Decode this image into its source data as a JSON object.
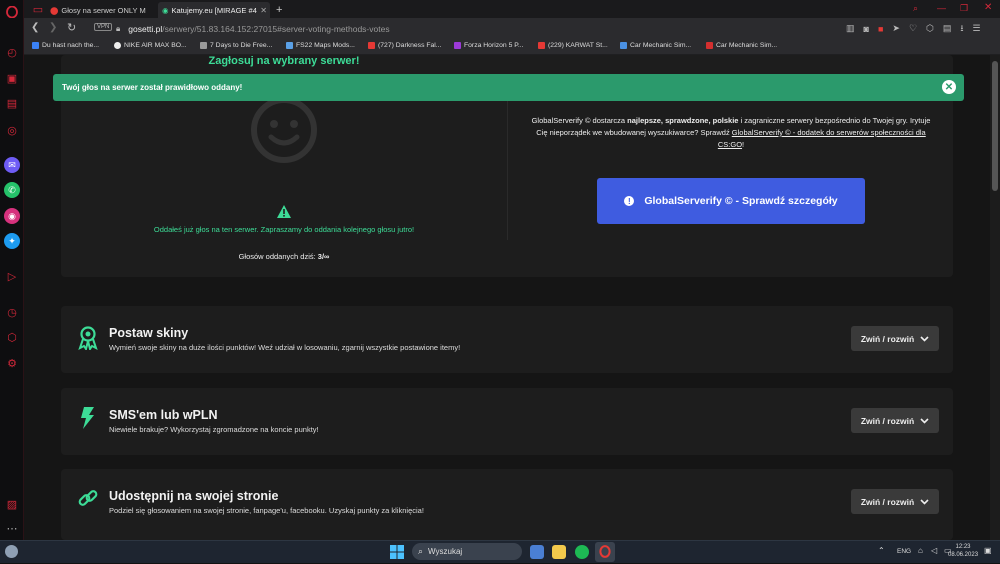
{
  "browser": {
    "tabs": [
      {
        "label": "Głosy na serwer ONLY M",
        "active": false
      },
      {
        "label": "Katujemy.eu [MIRAGE #4",
        "active": true
      }
    ],
    "new_tab": "+",
    "vpn": "VPN",
    "url_host": "gosetti.pl",
    "url_path": "/serwery/51.83.164.152:27015#server-voting-methods-votes",
    "bookmarks": [
      {
        "label": "Du hast nach the...",
        "color": "#3b82f6"
      },
      {
        "label": "NIKE AIR MAX BO...",
        "color": "#eeeeee"
      },
      {
        "label": "7 Days to Die Free...",
        "color": "#9a9a9a"
      },
      {
        "label": "FS22 Maps Mods...",
        "color": "#5aa0e6"
      },
      {
        "label": "(727) Darkness Fal...",
        "color": "#e53935"
      },
      {
        "label": "Forza Horizon 5 P...",
        "color": "#9c3ad8"
      },
      {
        "label": "(229) KARWAT St...",
        "color": "#e53935"
      },
      {
        "label": "Car Mechanic Sim...",
        "color": "#4a90e2"
      },
      {
        "label": "Car Mechanic Sim...",
        "color": "#d32f2f"
      }
    ]
  },
  "alert": {
    "message": "Twój głos na serwer został prawidłowo oddany!",
    "close": "✕"
  },
  "vote": {
    "heading": "Zagłosuj na wybrany serwer!",
    "already_voted": "Oddałeś już głos na ten serwer. Zapraszamy do oddania kolejnego głosu jutro!",
    "votes_today_label": "Głosów oddanych dziś:",
    "votes_today_value": "3/∞"
  },
  "promo": {
    "text_1": "GlobalServerify © dostarcza ",
    "text_bold": "najlepsze, sprawdzone, polskie",
    "text_2": " i zagraniczne serwery bezpośrednio do Twojej gry.",
    "text_3": "Irytuje Cię nieporządek we wbudowanej wyszukiwarce? Sprawdź ",
    "link": "GlobalServerify © - dodatek do serwerów społeczności dla CS:GO",
    "text_4": "!",
    "button": "GlobalServerify © - Sprawdź szczegóły"
  },
  "sections": [
    {
      "title": "Postaw skiny",
      "desc": "Wymień swoje skiny na duże ilości punktów! Weź udział w losowaniu, zgarnij wszystkie postawione itemy!",
      "toggle": "Zwiń / rozwiń",
      "icon": "award-icon"
    },
    {
      "title": "SMS'em lub wPLN",
      "desc": "Niewiele brakuje? Wykorzystaj zgromadzone na koncie punkty!",
      "toggle": "Zwiń / rozwiń",
      "icon": "lightning-icon"
    },
    {
      "title": "Udostępnij na swojej stronie",
      "desc": "Podziel się głosowaniem na swojej stronie, fanpage'u, facebooku. Uzyskaj punkty za kliknięcia!",
      "toggle": "Zwiń / rozwiń",
      "icon": "link-icon"
    }
  ],
  "taskbar": {
    "search_placeholder": "Wyszukaj",
    "lang": "ENG",
    "time": "12:23",
    "date": "08.06.2023"
  },
  "colors": {
    "accent_green": "#2b9a6c",
    "icon_green": "#3ddc97",
    "promo_blue": "#3f5ce0",
    "opera_red": "#d4283a"
  }
}
